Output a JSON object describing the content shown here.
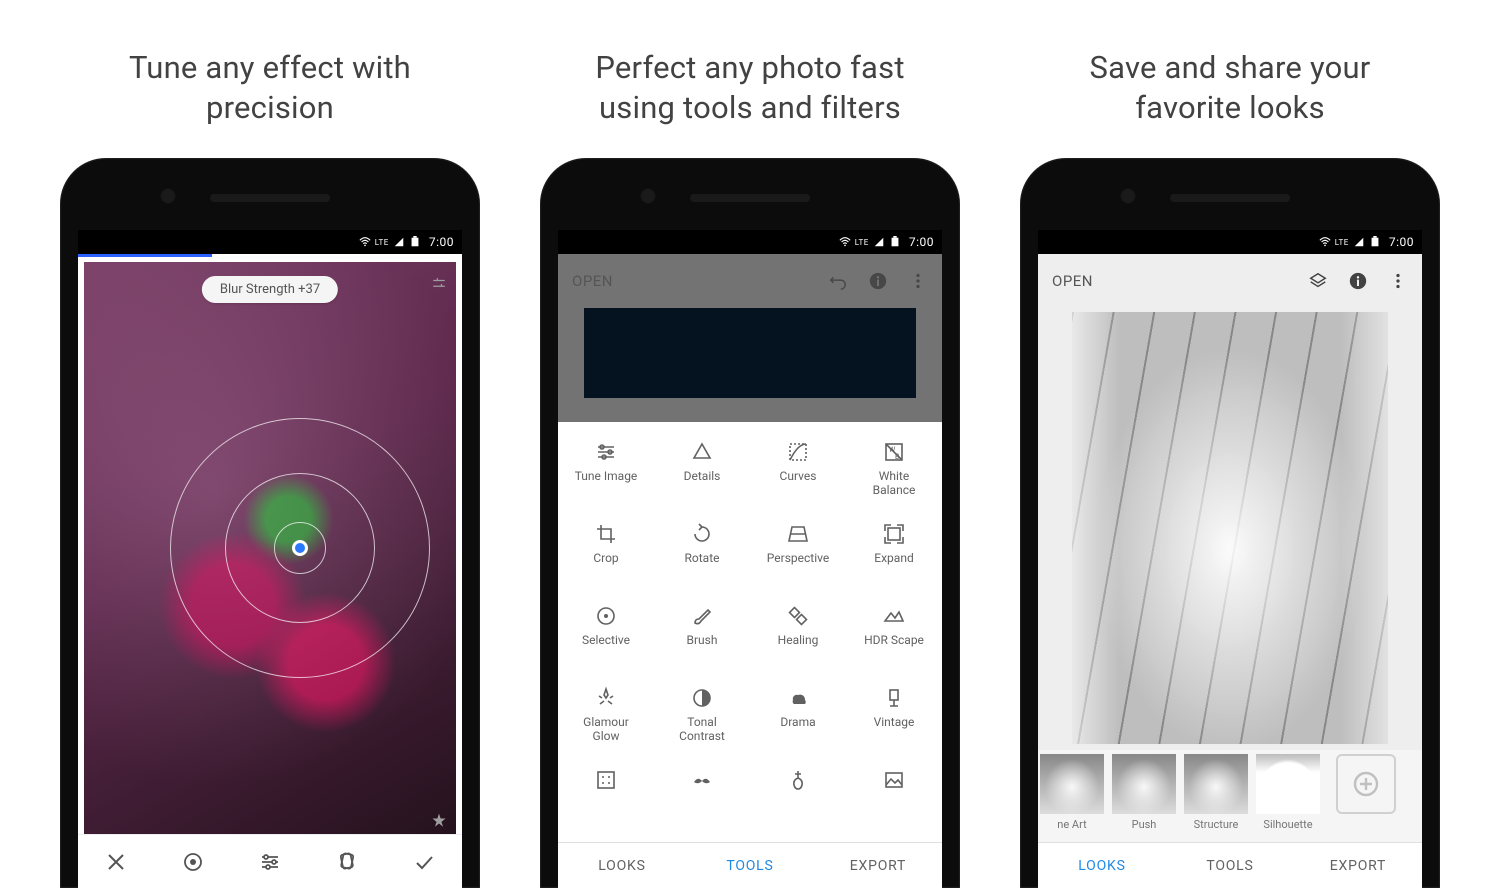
{
  "status": {
    "lte": "LTE",
    "time": "7:00"
  },
  "panel1": {
    "heading": "Tune any effect with\nprecision",
    "pill": "Blur Strength +37",
    "bottom_icons": [
      "close-icon",
      "radio-icon",
      "tune-icon",
      "styles-icon",
      "check-icon"
    ]
  },
  "panel2": {
    "heading": "Perfect any photo fast\nusing tools and filters",
    "open_label": "OPEN",
    "tools": [
      {
        "label": "Tune Image"
      },
      {
        "label": "Details"
      },
      {
        "label": "Curves"
      },
      {
        "label": "White\nBalance"
      },
      {
        "label": "Crop"
      },
      {
        "label": "Rotate"
      },
      {
        "label": "Perspective"
      },
      {
        "label": "Expand"
      },
      {
        "label": "Selective"
      },
      {
        "label": "Brush"
      },
      {
        "label": "Healing"
      },
      {
        "label": "HDR Scape"
      },
      {
        "label": "Glamour\nGlow"
      },
      {
        "label": "Tonal\nContrast"
      },
      {
        "label": "Drama"
      },
      {
        "label": "Vintage"
      },
      {
        "label": ""
      },
      {
        "label": ""
      },
      {
        "label": ""
      },
      {
        "label": ""
      }
    ],
    "row5_icons": [
      "frame-icon",
      "mustache-icon",
      "guitar-icon",
      "photo-icon"
    ],
    "tabs": {
      "looks": "LOOKS",
      "tools": "TOOLS",
      "export": "EXPORT",
      "active": "tools"
    }
  },
  "panel3": {
    "heading": "Save and share your\nfavorite looks",
    "open_label": "OPEN",
    "thumbs": [
      {
        "label": "ne Art"
      },
      {
        "label": "Push"
      },
      {
        "label": "Structure"
      },
      {
        "label": "Silhouette",
        "variant": "sil"
      }
    ],
    "tabs": {
      "looks": "LOOKS",
      "tools": "TOOLS",
      "export": "EXPORT",
      "active": "looks"
    }
  }
}
